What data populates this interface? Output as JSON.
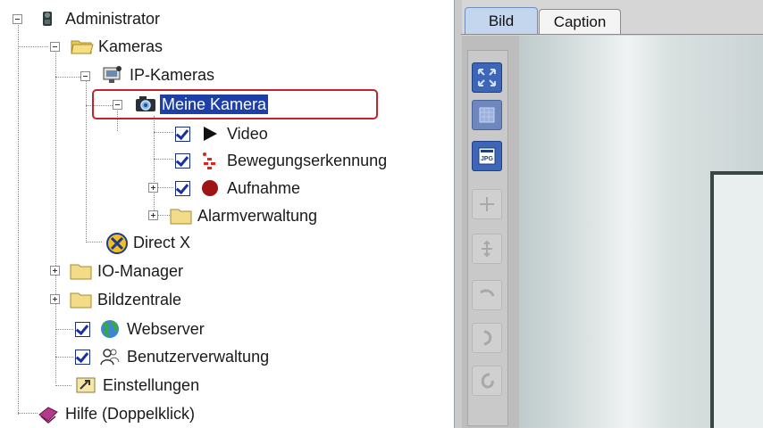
{
  "tree": {
    "nodes": [
      {
        "id": "administrator",
        "label": "Administrator",
        "icon": "administrator-icon"
      },
      {
        "id": "kameras",
        "label": "Kameras",
        "icon": "folder-open-icon"
      },
      {
        "id": "ip-kameras",
        "label": "IP-Kameras",
        "icon": "network-camera-icon"
      },
      {
        "id": "meine-kamera",
        "label": "Meine Kamera",
        "icon": "camera-icon",
        "selected": true
      },
      {
        "id": "video",
        "label": "Video",
        "icon": "play-icon",
        "checked": true
      },
      {
        "id": "bewegungserkennung",
        "label": "Bewegungserkennung",
        "icon": "motion-detection-icon",
        "checked": true
      },
      {
        "id": "aufnahme",
        "label": "Aufnahme",
        "icon": "record-icon",
        "checked": true
      },
      {
        "id": "alarmverwaltung",
        "label": "Alarmverwaltung",
        "icon": "folder-icon"
      },
      {
        "id": "direct-x",
        "label": "Direct X",
        "icon": "directx-icon"
      },
      {
        "id": "io-manager",
        "label": "IO-Manager",
        "icon": "folder-icon"
      },
      {
        "id": "bildzentrale",
        "label": "Bildzentrale",
        "icon": "folder-icon"
      },
      {
        "id": "webserver",
        "label": "Webserver",
        "icon": "globe-icon",
        "checked": true
      },
      {
        "id": "benutzerverwaltung",
        "label": "Benutzerverwaltung",
        "icon": "users-icon",
        "checked": true
      },
      {
        "id": "einstellungen",
        "label": "Einstellungen",
        "icon": "settings-icon"
      },
      {
        "id": "hilfe",
        "label": "Hilfe (Doppelklick)",
        "icon": "help-book-icon"
      }
    ]
  },
  "tabs": [
    {
      "id": "bild",
      "label": "Bild",
      "active": true
    },
    {
      "id": "caption",
      "label": "Caption",
      "active": false
    }
  ],
  "toolbar": {
    "buttons": [
      {
        "icon": "fit-to-window-icon",
        "enabled": true
      },
      {
        "icon": "fill-window-icon",
        "enabled": true
      },
      {
        "icon": "jpg-snapshot-icon",
        "enabled": true
      },
      {
        "icon": "zoom-in-icon",
        "enabled": false
      },
      {
        "icon": "zoom-out-icon",
        "enabled": false
      },
      {
        "icon": "rotate-right-icon",
        "enabled": false
      },
      {
        "icon": "rotate-flip-icon",
        "enabled": false
      },
      {
        "icon": "rotate-left-icon",
        "enabled": false
      }
    ]
  },
  "colors": {
    "selection": "#1f3fa8",
    "highlight_border": "#c0242c",
    "active_tab": "#c4d6ee",
    "toolbar_button_active": "#3d66b8"
  }
}
